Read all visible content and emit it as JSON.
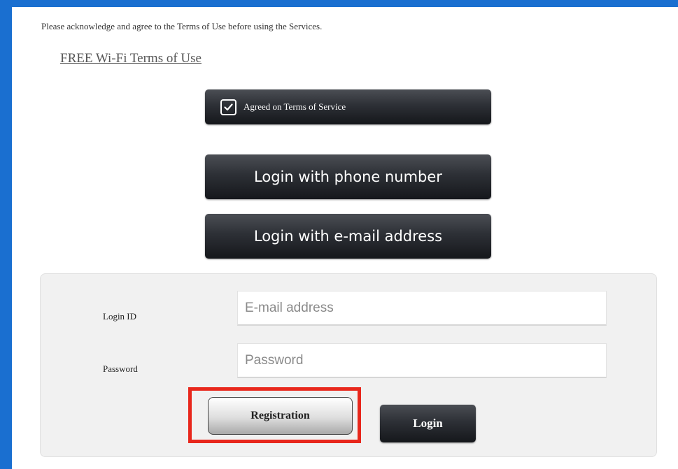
{
  "intro_text": "Please acknowledge and agree to the Terms of Use before using the Services.",
  "terms_link": "FREE Wi-Fi Terms of Use",
  "agree_button": {
    "label": "Agreed on Terms of Service",
    "checked": true,
    "icon": "checkbox-checked-icon"
  },
  "login_options": {
    "phone": "Login with phone number",
    "email": "Login with e-mail address"
  },
  "form": {
    "login_id_label": "Login ID",
    "login_id_placeholder": "E-mail address",
    "password_label": "Password",
    "password_placeholder": "Password",
    "registration_button": "Registration",
    "login_button": "Login"
  },
  "colors": {
    "frame_blue": "#1a6fd0",
    "highlight_red": "#e8271c",
    "dark_button": "#2d3036"
  }
}
